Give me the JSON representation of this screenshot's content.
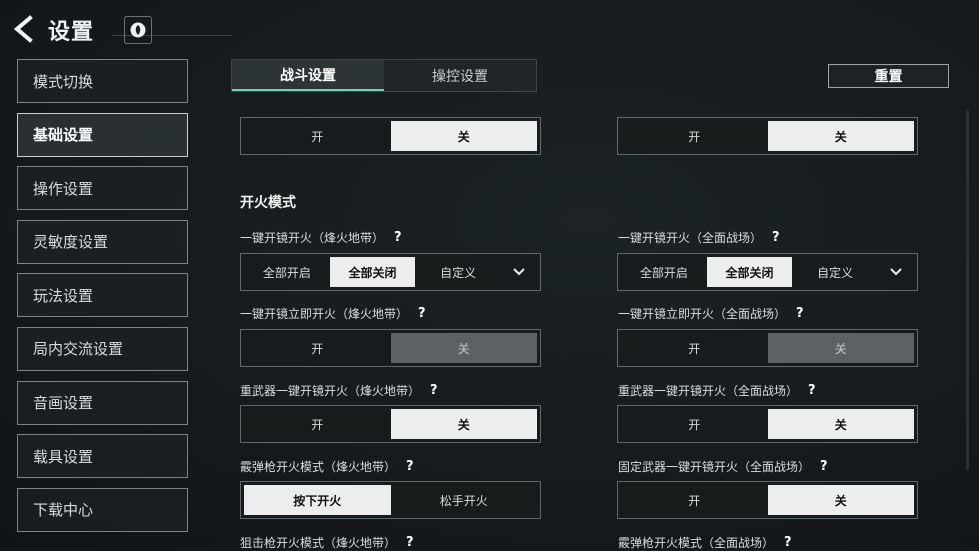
{
  "header": {
    "title": "设置"
  },
  "sidebar": {
    "items": [
      {
        "label": "模式切换"
      },
      {
        "label": "基础设置"
      },
      {
        "label": "操作设置"
      },
      {
        "label": "灵敏度设置"
      },
      {
        "label": "玩法设置"
      },
      {
        "label": "局内交流设置"
      },
      {
        "label": "音画设置"
      },
      {
        "label": "载具设置"
      },
      {
        "label": "下载中心"
      }
    ]
  },
  "tabs": [
    {
      "label": "战斗设置"
    },
    {
      "label": "操控设置"
    }
  ],
  "reset_label": "重置",
  "section_title": "开火模式",
  "top_toggles": [
    {
      "on": "开",
      "off": "关"
    },
    {
      "on": "开",
      "off": "关"
    }
  ],
  "settings": {
    "r1_left": {
      "label": "一键开镜开火（烽火地带）",
      "q": "?",
      "options": [
        "全部开启",
        "全部关闭",
        "自定义"
      ]
    },
    "r1_right": {
      "label": "一键开镜开火（全面战场）",
      "q": "?",
      "options": [
        "全部开启",
        "全部关闭",
        "自定义"
      ]
    },
    "r2_left": {
      "label": "一键开镜立即开火（烽火地带）",
      "q": "?",
      "options": [
        "开",
        "关"
      ]
    },
    "r2_right": {
      "label": "一键开镜立即开火（全面战场）",
      "q": "?",
      "options": [
        "开",
        "关"
      ]
    },
    "r3_left": {
      "label": "重武器一键开镜开火（烽火地带）",
      "q": "?",
      "options": [
        "开",
        "关"
      ]
    },
    "r3_right": {
      "label": "重武器一键开镜开火（全面战场）",
      "q": "?",
      "options": [
        "开",
        "关"
      ]
    },
    "r4_left": {
      "label": "霰弹枪开火模式（烽火地带）",
      "q": "?",
      "options": [
        "按下开火",
        "松手开火"
      ]
    },
    "r4_right": {
      "label": "固定武器一键开镜开火（全面战场）",
      "q": "?",
      "options": [
        "开",
        "关"
      ]
    },
    "r5_left": {
      "label": "狙击枪开火模式（烽火地带）",
      "q": "?"
    },
    "r5_right": {
      "label": "霰弹枪开火模式（全面战场）",
      "q": "?"
    }
  }
}
